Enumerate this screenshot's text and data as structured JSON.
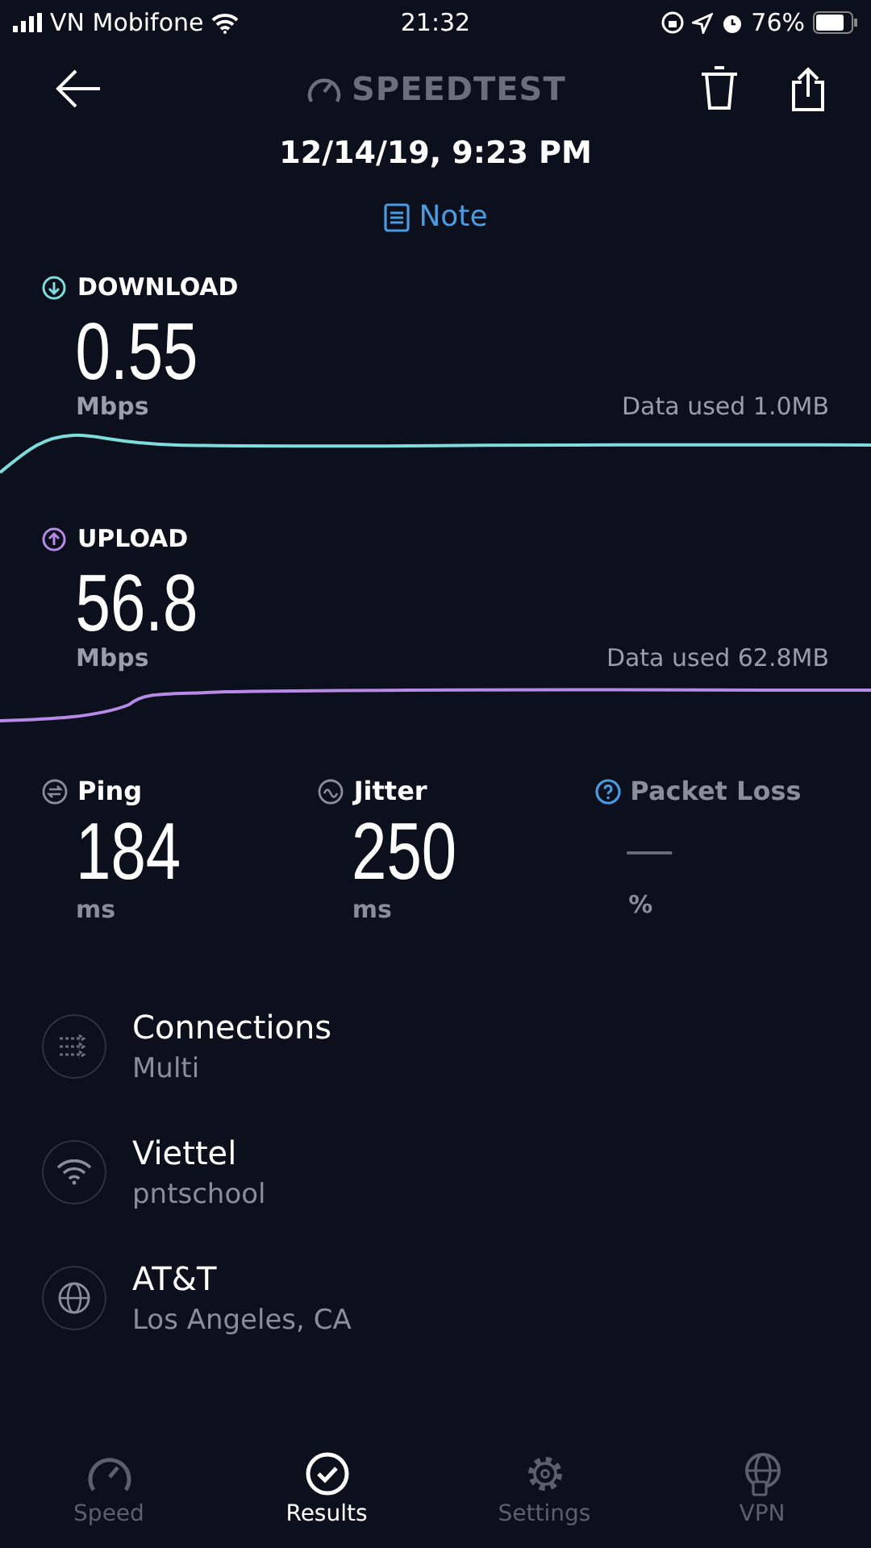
{
  "status_bar": {
    "carrier": "VN Mobifone",
    "time": "21:32",
    "battery": "76%"
  },
  "header": {
    "logo": "SPEEDTEST",
    "date": "12/14/19, 9:23 PM",
    "note": "Note"
  },
  "tests": [
    {
      "kind": "download",
      "label": "DOWNLOAD",
      "value": "0.55",
      "unit": "Mbps",
      "data_used": "Data used 1.0MB",
      "color": "#7fdcdc"
    },
    {
      "kind": "upload",
      "label": "UPLOAD",
      "value": "56.8",
      "unit": "Mbps",
      "data_used": "Data used 62.8MB",
      "color": "#b68ae6"
    }
  ],
  "metrics": [
    {
      "kind": "ping",
      "label": "Ping",
      "value": "184",
      "unit": "ms"
    },
    {
      "kind": "jitter",
      "label": "Jitter",
      "value": "250",
      "unit": "ms"
    },
    {
      "kind": "packet_loss",
      "label": "Packet Loss",
      "value": "—",
      "unit": "%"
    }
  ],
  "details": [
    {
      "kind": "connections",
      "title": "Connections",
      "subtitle": "Multi"
    },
    {
      "kind": "wifi",
      "title": "Viettel",
      "subtitle": "pntschool"
    },
    {
      "kind": "server",
      "title": "AT&T",
      "subtitle": "Los Angeles, CA"
    }
  ],
  "tabs": [
    {
      "kind": "speed",
      "label": "Speed",
      "selected": false
    },
    {
      "kind": "results",
      "label": "Results",
      "selected": true
    },
    {
      "kind": "settings",
      "label": "Settings",
      "selected": false
    },
    {
      "kind": "vpn",
      "label": "VPN",
      "selected": false
    }
  ]
}
